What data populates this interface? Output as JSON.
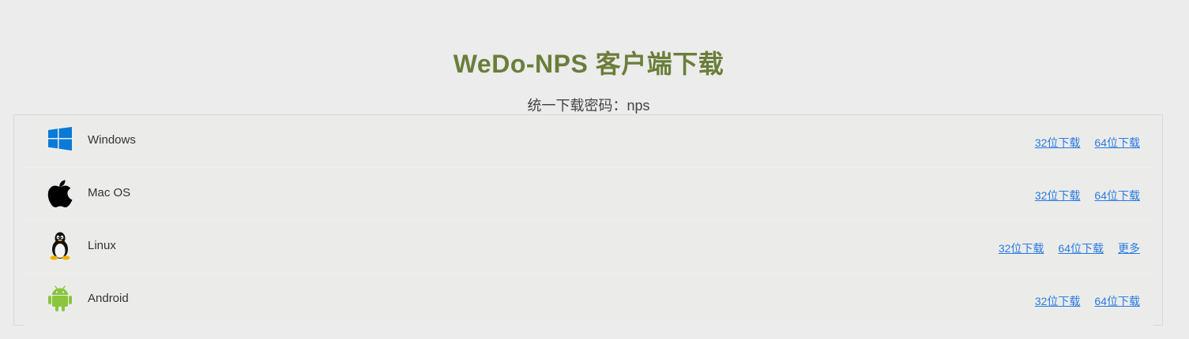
{
  "header": {
    "title": "WeDo-NPS 客户端下载",
    "password_line": "统一下载密码：nps"
  },
  "platforms": [
    {
      "name": "Windows",
      "icon": "windows-icon",
      "links": [
        "32位下载",
        "64位下载"
      ]
    },
    {
      "name": "Mac OS",
      "icon": "apple-icon",
      "links": [
        "32位下载",
        "64位下载"
      ]
    },
    {
      "name": "Linux",
      "icon": "linux-tux-icon",
      "links": [
        "32位下载",
        "64位下载",
        "更多"
      ]
    },
    {
      "name": "Android",
      "icon": "android-icon",
      "links": [
        "32位下载",
        "64位下载"
      ]
    }
  ],
  "colors": {
    "title": "#6b7d3a",
    "link": "#2a7ae2",
    "windows_blue": "#0a7ad8",
    "android_green": "#8ac53e"
  }
}
